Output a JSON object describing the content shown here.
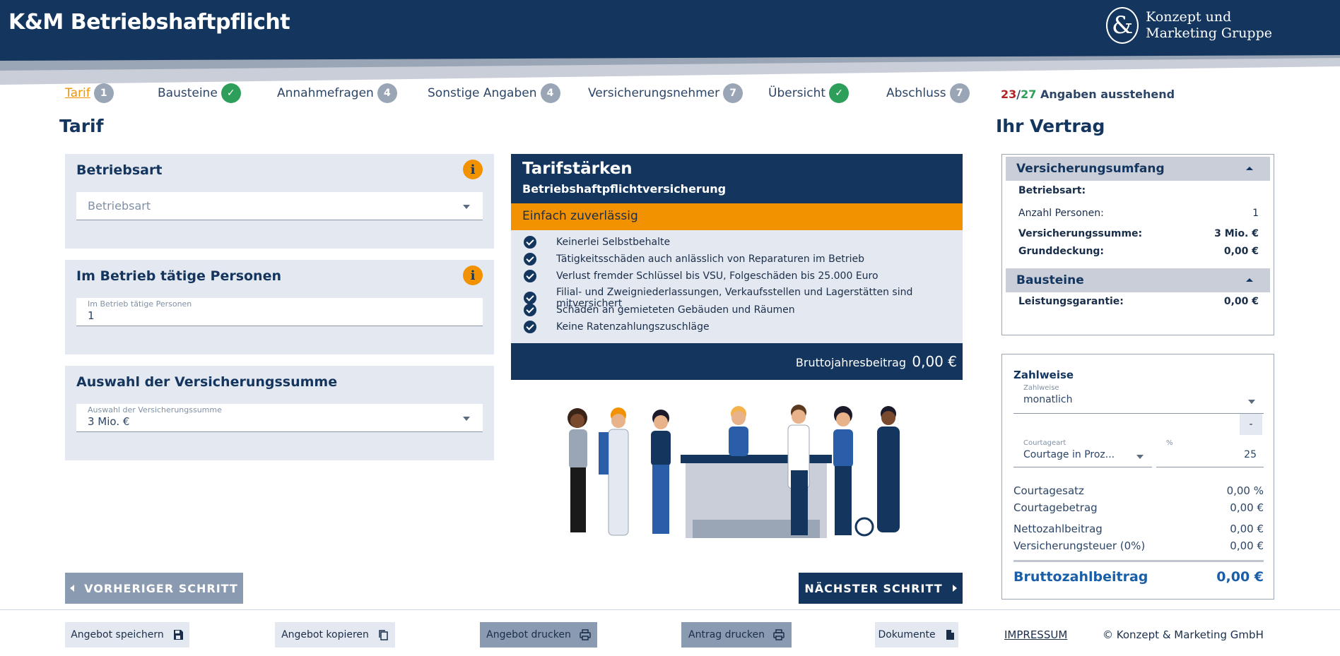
{
  "header": {
    "app_title": "K&M Betriebshaftpflicht",
    "brand_mark": "&",
    "brand_line1": "Konzept und",
    "brand_line2": "Marketing Gruppe"
  },
  "steps": [
    {
      "label": "Tarif",
      "badge": "1",
      "state": "active"
    },
    {
      "label": "Bausteine",
      "badge": "✓",
      "state": "done"
    },
    {
      "label": "Annahmefragen",
      "badge": "4",
      "state": "open"
    },
    {
      "label": "Sonstige Angaben",
      "badge": "4",
      "state": "open"
    },
    {
      "label": "Versicherungsnehmer",
      "badge": "7",
      "state": "open"
    },
    {
      "label": "Übersicht",
      "badge": "✓",
      "state": "done"
    },
    {
      "label": "Abschluss",
      "badge": "7",
      "state": "open"
    }
  ],
  "pending": {
    "open": "23",
    "slash": "/",
    "total": "27",
    "text": "Angaben ausstehend"
  },
  "tarif": {
    "heading": "Tarif",
    "cards": {
      "betriebsart": {
        "title": "Betriebsart",
        "placeholder": "Betriebsart",
        "info": "i"
      },
      "personen": {
        "title": "Im Betrieb tätige Personen",
        "field_label": "Im Betrieb tätige Personen",
        "value": "1",
        "info": "i"
      },
      "summe": {
        "title": "Auswahl der Versicherungssumme",
        "field_label": "Auswahl der Versicherungssumme",
        "value": "3 Mio. €"
      }
    }
  },
  "strengths": {
    "title": "Tarifstärken",
    "subtitle": "Betriebshaftpflichtversicherung",
    "highlight": "Einfach zuverlässig",
    "items": [
      "Keinerlei Selbstbehalte",
      "Tätigkeitsschäden auch anlässlich von Reparaturen im Betrieb",
      "Verlust fremder Schlüssel bis VSU, Folgeschäden bis 25.000 Euro",
      "Filial- und Zweigniederlassungen, Verkaufsstellen und Lagerstätten sind mitversichert",
      "Schäden an gemieteten Gebäuden und Räumen",
      "Keine Ratenzahlungszuschläge"
    ],
    "footer_label": "Bruttojahresbeitrag",
    "footer_value": "0,00 €"
  },
  "nav": {
    "prev": "VORHERIGER SCHRITT",
    "next": "NÄCHSTER SCHRITT"
  },
  "contract": {
    "heading": "Ihr Vertrag",
    "scope_title": "Versicherungsumfang",
    "rows": [
      {
        "label": "Betriebsart:",
        "value": ""
      },
      {
        "label": "Anzahl Personen:",
        "value": "1"
      },
      {
        "label": "Versicherungssumme:",
        "value": "3 Mio. €"
      },
      {
        "label": "Grunddeckung:",
        "value": "0,00 €"
      }
    ],
    "modules_title": "Bausteine",
    "modules": [
      {
        "label": "Leistungsgarantie:",
        "value": "0,00 €"
      }
    ]
  },
  "payment": {
    "title": "Zahlweise",
    "zahlweise_label": "Zahlweise",
    "zahlweise_value": "monatlich",
    "minus": "-",
    "courtageart_label": "Courtageart",
    "courtageart_value": "Courtage in Proz...",
    "percent_label": "%",
    "percent_value": "25",
    "rows": [
      {
        "label": "Courtagesatz",
        "value": "0,00 %"
      },
      {
        "label": "Courtagebetrag",
        "value": "0,00 €"
      },
      {
        "label": "Nettozahlbeitrag",
        "value": "0,00 €"
      },
      {
        "label": "Versicherungsteuer (0%)",
        "value": "0,00 €"
      }
    ],
    "total_label": "Bruttozahlbeitrag",
    "total_value": "0,00 €"
  },
  "footer": {
    "save": "Angebot speichern",
    "copy": "Angebot kopieren",
    "print_offer": "Angebot drucken",
    "print_application": "Antrag drucken",
    "documents": "Dokumente",
    "impressum": "IMPRESSUM",
    "copyright": "© Konzept & Marketing GmbH"
  },
  "colors": {
    "primary": "#14365e",
    "accent": "#f39200",
    "success": "#2e9e5b",
    "panel": "#e4e8f0"
  }
}
